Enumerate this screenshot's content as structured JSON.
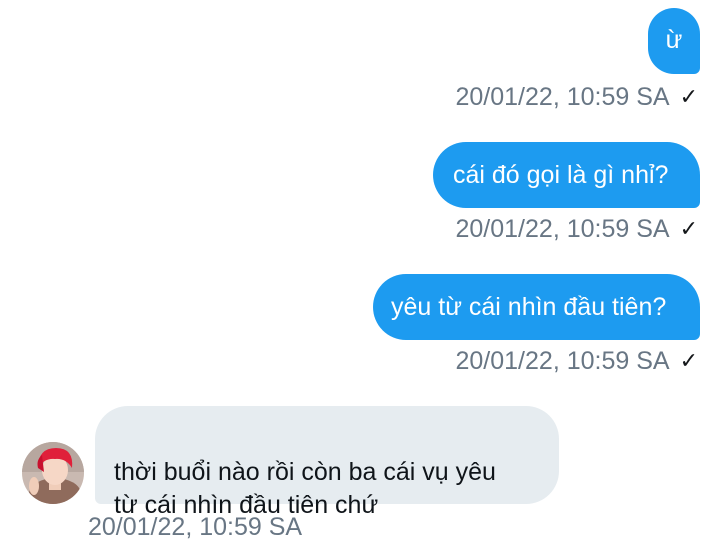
{
  "messages": [
    {
      "direction": "outgoing",
      "text": "ừ",
      "timestamp": "20/01/22, 10:59 SA",
      "status_icon": "check-icon"
    },
    {
      "direction": "outgoing",
      "text": "cái đó gọi là gì nhỉ?",
      "timestamp": "20/01/22, 10:59 SA",
      "status_icon": "check-icon"
    },
    {
      "direction": "outgoing",
      "text": "yêu từ cái nhìn đầu tiên?",
      "timestamp": "20/01/22, 10:59 SA",
      "status_icon": "check-icon"
    },
    {
      "direction": "incoming",
      "text": "thời buổi nào rồi còn ba cái vụ yêu\ntừ cái nhìn đầu tiên chứ",
      "timestamp": "20/01/22, 10:59 SA"
    }
  ],
  "colors": {
    "outgoing_bubble": "#1d9bf0",
    "incoming_bubble": "#e6ecf0",
    "timestamp_text": "#687684"
  }
}
